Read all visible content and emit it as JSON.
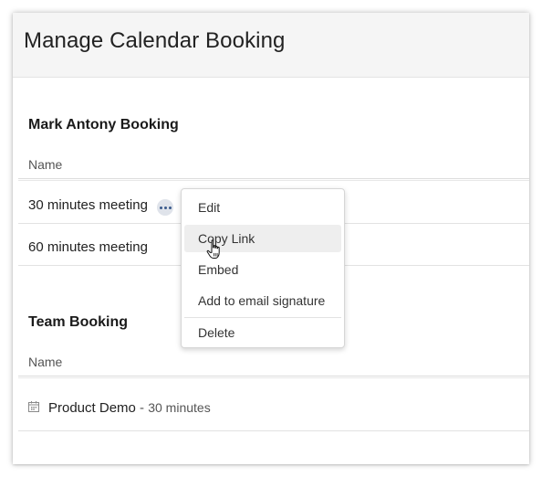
{
  "page": {
    "title": "Manage Calendar Booking"
  },
  "personal": {
    "title": "Mark Antony Booking",
    "column": "Name",
    "rows": [
      {
        "name": "30 minutes meeting"
      },
      {
        "name": "60 minutes meeting"
      }
    ]
  },
  "context_menu": {
    "items": [
      "Edit",
      "Copy Link",
      "Embed",
      "Add to email signature"
    ],
    "danger": "Delete",
    "hovered": "Copy Link"
  },
  "team": {
    "title": "Team Booking",
    "column": "Name",
    "rows": [
      {
        "name": "Product Demo",
        "separator": "-",
        "duration": "30 minutes"
      }
    ]
  },
  "icons": {
    "more": "ellipsis-icon",
    "calendar": "calendar-icon",
    "cursor": "hand-pointer-icon"
  }
}
